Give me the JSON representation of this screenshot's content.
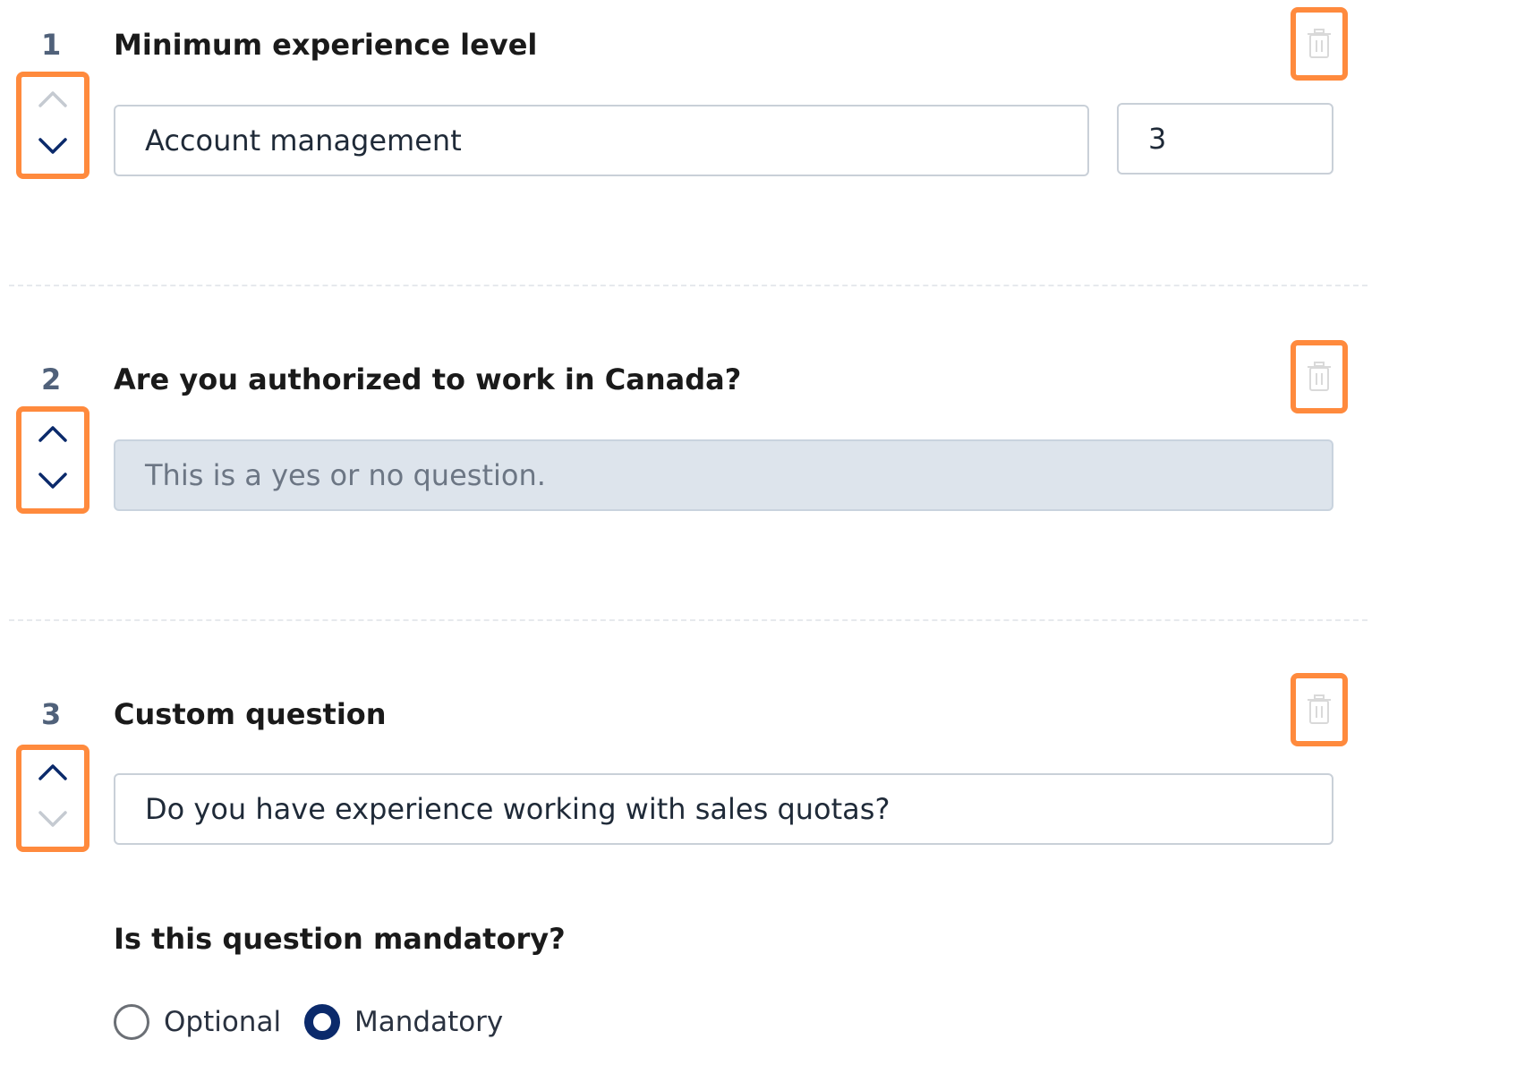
{
  "questions": [
    {
      "number": "1",
      "title": "Minimum experience level",
      "skill_value": "Account management",
      "years_value": "3",
      "move_up_enabled": false,
      "move_down_enabled": true
    },
    {
      "number": "2",
      "title": "Are you authorized to work in Canada?",
      "info_text": "This is a yes or no question.",
      "move_up_enabled": true,
      "move_down_enabled": true
    },
    {
      "number": "3",
      "title": "Custom question",
      "question_value": "Do you have experience working with sales quotas?",
      "move_up_enabled": true,
      "move_down_enabled": false
    }
  ],
  "mandatory": {
    "label": "Is this question mandatory?",
    "options": [
      "Optional",
      "Mandatory"
    ],
    "selected": "Mandatory"
  },
  "colors": {
    "highlight": "#ff8a3d",
    "chevron_enabled": "#0b2a6b",
    "chevron_disabled": "#c5cad1",
    "radio_selected": "#0b2a6b",
    "disabled_field_bg": "#dde4ec"
  },
  "icons": {
    "move_up": "chevron-up-icon",
    "move_down": "chevron-down-icon",
    "delete": "trash-icon"
  }
}
